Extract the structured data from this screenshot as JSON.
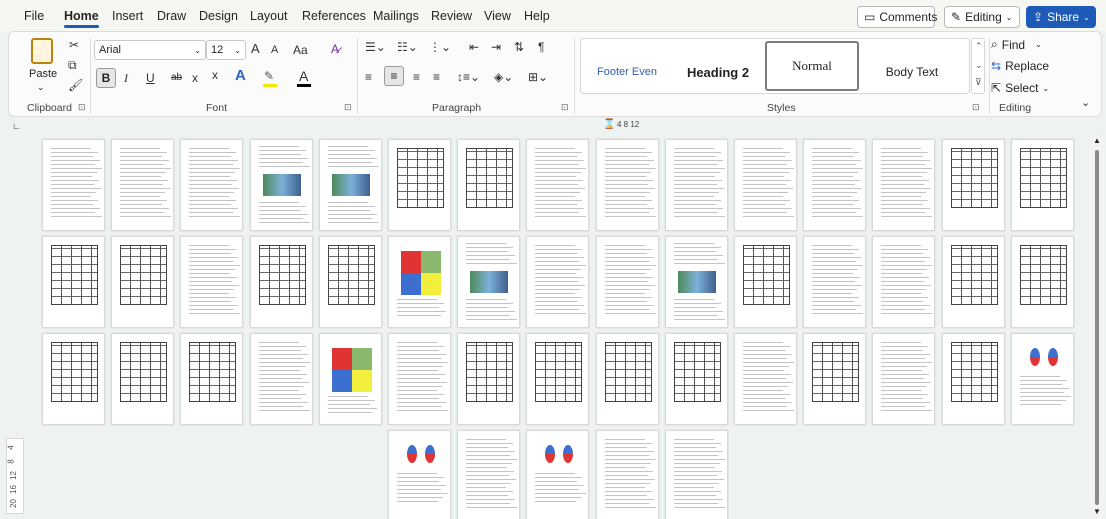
{
  "menu": {
    "tabs": [
      "File",
      "Home",
      "Insert",
      "Draw",
      "Design",
      "Layout",
      "References",
      "Mailings",
      "Review",
      "View",
      "Help"
    ],
    "active_tab": "Home",
    "comments_label": "Comments",
    "editing_label": "Editing",
    "share_label": "Share"
  },
  "ribbon": {
    "clipboard": {
      "paste_label": "Paste",
      "group_label": "Clipboard"
    },
    "font": {
      "font_name": "Arial",
      "font_size": "12",
      "group_label": "Font",
      "bold": "B",
      "italic": "I",
      "underline": "U",
      "strike": "ab",
      "sub": "x",
      "sup": "x",
      "grow": "A",
      "shrink": "A",
      "case": "Aa",
      "effects": "A",
      "highlight": "✎",
      "color": "A"
    },
    "paragraph": {
      "group_label": "Paragraph"
    },
    "styles": {
      "group_label": "Styles",
      "items": [
        "Footer Even",
        "Heading 2",
        "Normal",
        "Body Text"
      ]
    },
    "editing": {
      "group_label": "Editing",
      "find": "Find",
      "replace": "Replace",
      "select": "Select"
    }
  },
  "ruler": {
    "labels": "4  8  12"
  },
  "vertical_ruler": {
    "labels": [
      "4",
      "8",
      "12",
      "16",
      "20"
    ]
  },
  "colors": {
    "accent": "#1e5bb8",
    "background": "#eef2f0"
  }
}
